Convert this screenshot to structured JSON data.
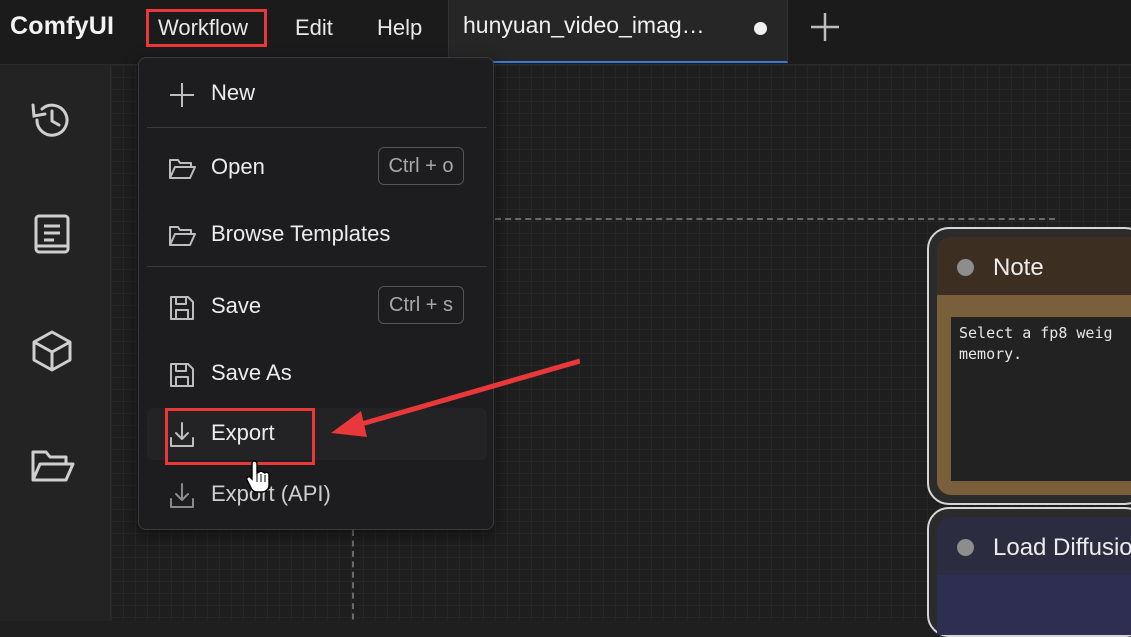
{
  "app": {
    "title": "ComfyUI"
  },
  "menubar": {
    "items": [
      {
        "label": "Workflow"
      },
      {
        "label": "Edit"
      },
      {
        "label": "Help"
      }
    ]
  },
  "tabs": [
    {
      "title": "hunyuan_video_imag…",
      "modified": true
    }
  ],
  "add_tab_icon": "plus-icon",
  "sidebar": {
    "icons": [
      "history-icon",
      "book-icon",
      "cube-icon",
      "folder-icon"
    ]
  },
  "workflow_menu": {
    "items": [
      {
        "label": "New",
        "icon": "plus-icon"
      },
      {
        "label": "Open",
        "icon": "folder-open-icon",
        "shortcut": "Ctrl + o"
      },
      {
        "label": "Browse Templates",
        "icon": "folder-open-icon"
      },
      {
        "label": "Save",
        "icon": "floppy-icon",
        "shortcut": "Ctrl + s"
      },
      {
        "label": "Save As",
        "icon": "floppy-icon"
      },
      {
        "label": "Export",
        "icon": "download-icon"
      },
      {
        "label": "Export (API)",
        "icon": "download-icon"
      }
    ]
  },
  "nodes": {
    "note": {
      "title": "Note",
      "text": "Select a fp8 weig\nmemory."
    },
    "load": {
      "title": "Load Diffusio"
    }
  },
  "colors": {
    "highlight": "#e8383a",
    "tab_accent": "#3a7bd5",
    "note_color": "#7a5f3c",
    "load_color": "#2e2e52"
  }
}
